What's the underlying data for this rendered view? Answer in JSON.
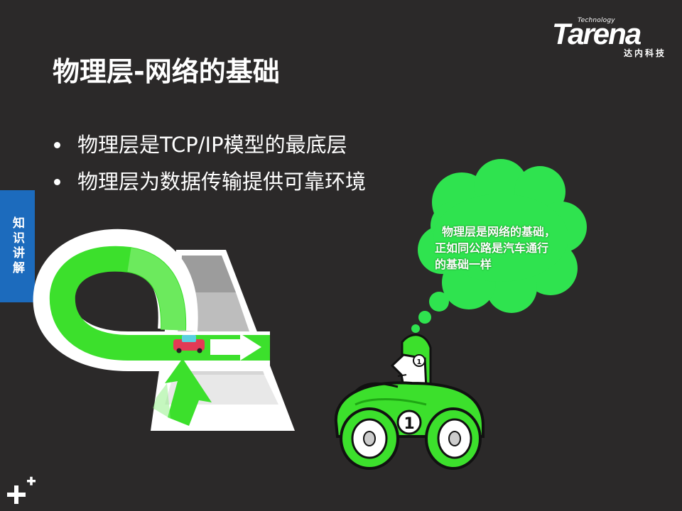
{
  "brand": {
    "small": "Technology",
    "name": "Tarena",
    "sub": "达内科技"
  },
  "slide": {
    "title": "物理层-网络的基础",
    "bullets": [
      "物理层是TCP/IP模型的最底层",
      "物理层为数据传输提供可靠环境"
    ]
  },
  "side_tab": {
    "label": "知识讲解"
  },
  "thought_bubble": {
    "lines": [
      "物理层是网络的基础，",
      "正如同公路是汽车通行",
      "的基础一样"
    ]
  },
  "car": {
    "number": "1"
  },
  "colors": {
    "background": "#2b2929",
    "accent_green": "#3ce02c",
    "tab_blue": "#1c6bbd"
  },
  "icons": [
    "plus-plus-icon",
    "arrow-right-icon",
    "arrow-up-icon"
  ]
}
